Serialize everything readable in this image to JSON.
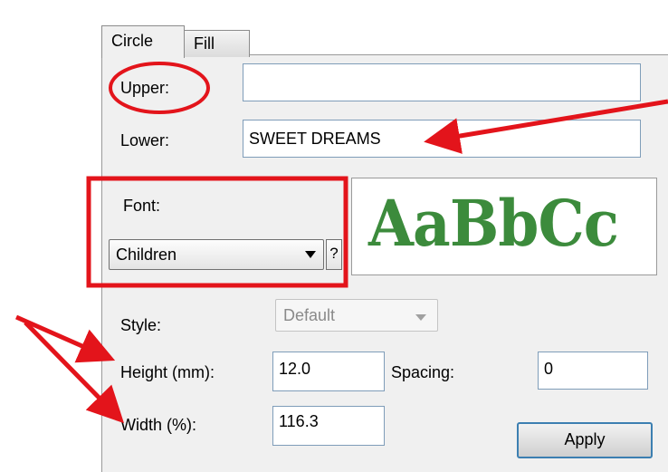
{
  "tabs": [
    {
      "label": "Circle",
      "active": true
    },
    {
      "label": "Fill",
      "active": false
    }
  ],
  "upper": {
    "label": "Upper:",
    "value": ""
  },
  "lower": {
    "label": "Lower:",
    "value": "SWEET DREAMS"
  },
  "font": {
    "label": "Font:",
    "selected": "Children",
    "help": "?"
  },
  "preview": {
    "sample": "AaBbCc",
    "color": "#3c8b3c"
  },
  "style": {
    "label": "Style:",
    "selected": "Default"
  },
  "height": {
    "label": "Height (mm):",
    "value": "12.0"
  },
  "spacing": {
    "label": "Spacing:",
    "value": "0"
  },
  "width": {
    "label": "Width (%):",
    "value": "116.3"
  },
  "apply_label": "Apply",
  "annotation_color": "#e3141b"
}
